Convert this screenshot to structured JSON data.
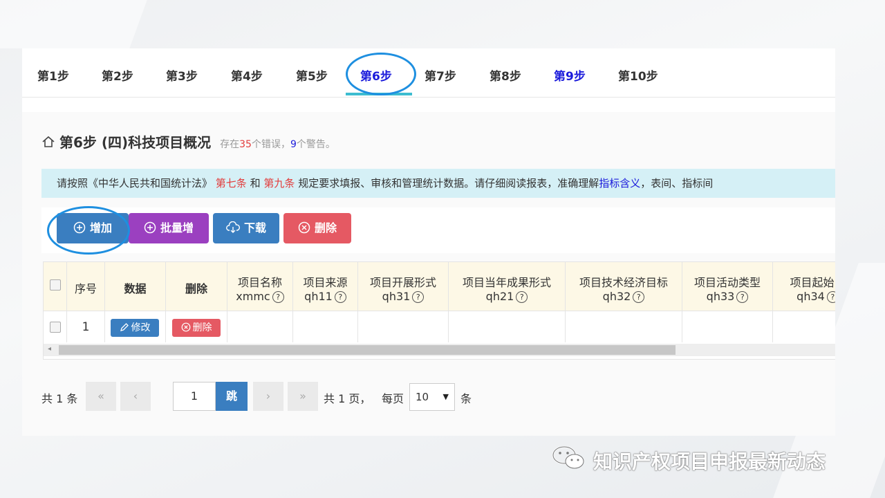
{
  "steps": [
    "第1步",
    "第2步",
    "第3步",
    "第4步",
    "第5步",
    "第6步",
    "第7步",
    "第8步",
    "第9步",
    "第10步"
  ],
  "active_step": "第6步",
  "page": {
    "title": "第6步 (四)科技项目概况",
    "err_prefix": "存在",
    "err_count": "35",
    "err_suffix": "个错误，",
    "warn_count": "9",
    "warn_suffix": "个警告。"
  },
  "notice": {
    "part1": "请按照《中华人民共和国统计法》",
    "art7": "第七条",
    "and": "和",
    "art9": "第九条",
    "part2": "规定要求填报、审核和管理统计数据。请仔细阅读报表，准确理解",
    "link": "指标含义",
    "part3": "，表间、指标间"
  },
  "toolbar": {
    "add": "增加",
    "batch_add": "批量增",
    "download": "下载",
    "delete": "删除"
  },
  "table": {
    "headers": {
      "seq": "序号",
      "data": "数据",
      "delete": "删除",
      "name": "项目名称",
      "name_code": "xmmc",
      "source": "项目来源",
      "source_code": "qh11",
      "form": "项目开展形式",
      "form_code": "qh31",
      "result": "项目当年成果形式",
      "result_code": "qh21",
      "target": "项目技术经济目标",
      "target_code": "qh32",
      "activity": "项目活动类型",
      "activity_code": "qh33",
      "start": "项目起始日",
      "start_code": "qh34"
    },
    "help_glyph": "?",
    "rows": [
      {
        "seq": "1",
        "edit_label": "修改",
        "delete_label": "删除"
      }
    ]
  },
  "pager": {
    "total_prefix": "共",
    "total_records": "1",
    "total_suffix": "条",
    "first": "«",
    "prev": "‹",
    "current_page": "1",
    "go_label": "跳",
    "next": "›",
    "last": "»",
    "pages_prefix": "共",
    "total_pages": "1",
    "pages_suffix": "页，",
    "per_page_label": "每页",
    "page_size": "10",
    "page_size_suffix": "条"
  },
  "watermark": "知识产权项目申报最新动态",
  "colors": {
    "accent_blue": "#3a7ec0",
    "purple": "#9b40c0",
    "red": "#e55963",
    "error_red": "#e23b3b",
    "link_blue": "#1a1adb",
    "notice_bg": "#d5f0f6",
    "header_bg": "#fdf8e6",
    "highlight_circle": "#1e8fe0"
  }
}
